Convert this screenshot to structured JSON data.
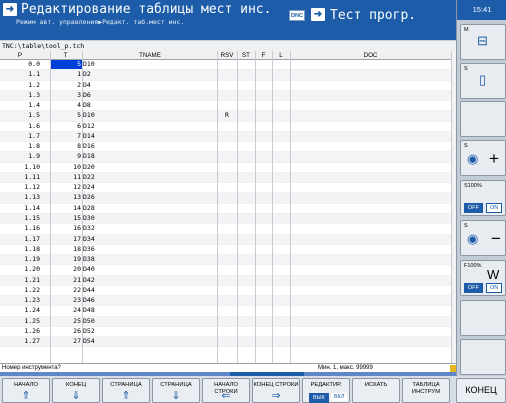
{
  "header": {
    "mode_title": "Редактирование таблицы мест инс.",
    "mode_subtitle": "Режим авт. управления▶Редакт. таб.мест инс.",
    "dnc_label": "DNC",
    "program_title": "Тест прогр."
  },
  "clock": "15:41",
  "file_path": "TNC:\\table\\tool_p.tch",
  "table": {
    "columns": [
      "P",
      "T",
      "TNAME",
      "RSV",
      "ST",
      "F",
      "L",
      "DOC"
    ],
    "rows": [
      {
        "p": "0.0",
        "t": "5",
        "tname": "D10",
        "rsv": ""
      },
      {
        "p": "1.1",
        "t": "1",
        "tname": "D2",
        "rsv": ""
      },
      {
        "p": "1.2",
        "t": "2",
        "tname": "D4",
        "rsv": ""
      },
      {
        "p": "1.3",
        "t": "3",
        "tname": "D6",
        "rsv": ""
      },
      {
        "p": "1.4",
        "t": "4",
        "tname": "D8",
        "rsv": ""
      },
      {
        "p": "1.5",
        "t": "5",
        "tname": "D10",
        "rsv": "R"
      },
      {
        "p": "1.6",
        "t": "6",
        "tname": "D12",
        "rsv": ""
      },
      {
        "p": "1.7",
        "t": "7",
        "tname": "D14",
        "rsv": ""
      },
      {
        "p": "1.8",
        "t": "8",
        "tname": "D16",
        "rsv": ""
      },
      {
        "p": "1.9",
        "t": "9",
        "tname": "D18",
        "rsv": ""
      },
      {
        "p": "1.10",
        "t": "10",
        "tname": "D20",
        "rsv": ""
      },
      {
        "p": "1.11",
        "t": "11",
        "tname": "D22",
        "rsv": ""
      },
      {
        "p": "1.12",
        "t": "12",
        "tname": "D24",
        "rsv": ""
      },
      {
        "p": "1.13",
        "t": "13",
        "tname": "D26",
        "rsv": ""
      },
      {
        "p": "1.14",
        "t": "14",
        "tname": "D28",
        "rsv": ""
      },
      {
        "p": "1.15",
        "t": "15",
        "tname": "D30",
        "rsv": ""
      },
      {
        "p": "1.16",
        "t": "16",
        "tname": "D32",
        "rsv": ""
      },
      {
        "p": "1.17",
        "t": "17",
        "tname": "D34",
        "rsv": ""
      },
      {
        "p": "1.18",
        "t": "18",
        "tname": "D36",
        "rsv": ""
      },
      {
        "p": "1.19",
        "t": "19",
        "tname": "D38",
        "rsv": ""
      },
      {
        "p": "1.20",
        "t": "20",
        "tname": "D40",
        "rsv": ""
      },
      {
        "p": "1.21",
        "t": "21",
        "tname": "D42",
        "rsv": ""
      },
      {
        "p": "1.22",
        "t": "22",
        "tname": "D44",
        "rsv": ""
      },
      {
        "p": "1.23",
        "t": "23",
        "tname": "D46",
        "rsv": ""
      },
      {
        "p": "1.24",
        "t": "24",
        "tname": "D48",
        "rsv": ""
      },
      {
        "p": "1.25",
        "t": "25",
        "tname": "D50",
        "rsv": ""
      },
      {
        "p": "1.26",
        "t": "26",
        "tname": "D52",
        "rsv": ""
      },
      {
        "p": "1.27",
        "t": "27",
        "tname": "D54",
        "rsv": ""
      }
    ]
  },
  "status": {
    "prompt": "Номер инструмента?",
    "range_hint": "Мин. 1, макс. 99999"
  },
  "right_panel": {
    "m_label": "M",
    "s_label": "S",
    "s_plus_label": "S",
    "s100_label": "S100%",
    "off_label": "OFF",
    "on_label": "ON",
    "s_minus_label": "S",
    "f100_label": "F100%",
    "off2_label": "OFF",
    "on2_label": "ON"
  },
  "softkeys": [
    {
      "label": "НАЧАЛО",
      "arrow": "⇑"
    },
    {
      "label": "КОНЕЦ",
      "arrow": "⇓"
    },
    {
      "label": "СТРАНИЦА",
      "arrow": "⇑"
    },
    {
      "label": "СТРАНИЦА",
      "arrow": "⇓"
    },
    {
      "label": "НАЧАЛО СТРОКИ",
      "arrow": "⇐"
    },
    {
      "label": "КОНЕЦ СТРОКИ",
      "arrow": "⇒"
    },
    {
      "label": "РЕДАКТИР.",
      "sub_on": "ВЫК",
      "sub_off": "ВКЛ"
    },
    {
      "label": "ИСКАТЬ",
      "arrow": ""
    },
    {
      "label": "ТАБЛИЦА ИНСТРУМ",
      "arrow": ""
    }
  ],
  "end_key": "КОНЕЦ",
  "colors": {
    "header_blue": "#1c5ca8",
    "selection": "#0040d8"
  }
}
